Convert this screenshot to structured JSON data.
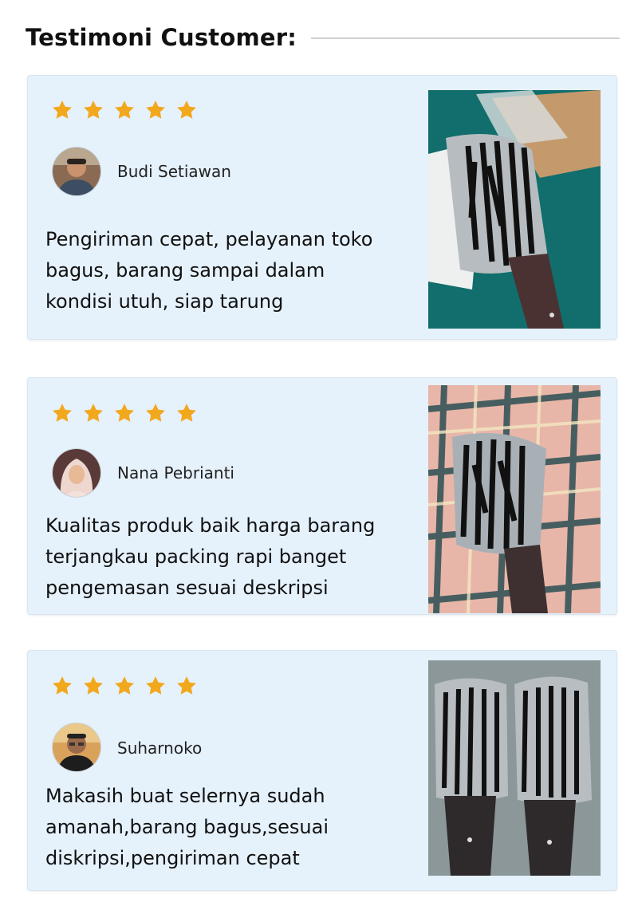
{
  "section": {
    "title": "Testimoni Customer:"
  },
  "testimonials": [
    {
      "rating": 5,
      "name": "Budi Setiawan",
      "review_lines": [
        "Pengiriman cepat, pelayanan toko",
        "bagus, barang sampai dalam",
        "kondisi utuh, siap tarung"
      ],
      "avatar_icon": "avatar-photo-man-icon",
      "photo_icon": "cleaver-knife-photo-icon"
    },
    {
      "rating": 5,
      "name": "Nana Pebrianti",
      "review_lines": [
        "Kualitas produk baik harga barang",
        "terjangkau packing rapi banget",
        "pengemasan sesuai deskripsi"
      ],
      "avatar_icon": "avatar-photo-woman-hijab-icon",
      "photo_icon": "cleaver-knife-on-tablecloth-photo-icon"
    },
    {
      "rating": 5,
      "name": "Suharnoko",
      "review_lines": [
        "Makasih buat selernya sudah",
        "amanah,barang bagus,sesuai",
        "diskripsi,pengiriman cepat"
      ],
      "avatar_icon": "avatar-photo-man-glasses-icon",
      "photo_icon": "two-cleaver-knives-photo-icon"
    }
  ],
  "colors": {
    "card_bg": "#e5f1fb",
    "star": "#f2a81d",
    "divider": "#cfcfcf"
  }
}
